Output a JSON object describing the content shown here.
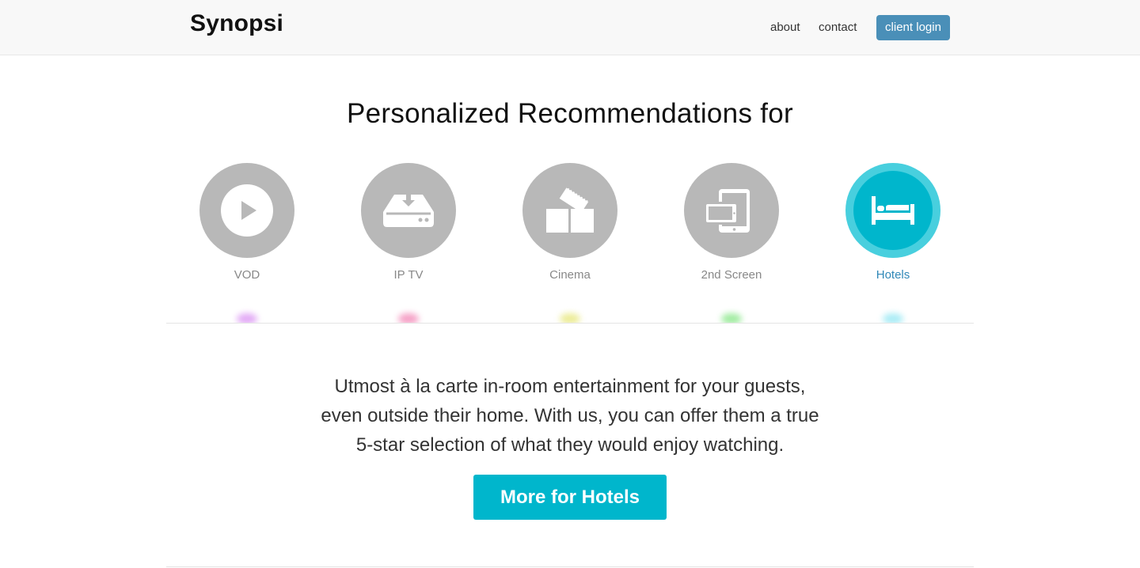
{
  "navbar": {
    "brand": "Synopsi",
    "links": [
      {
        "label": "about"
      },
      {
        "label": "contact"
      }
    ],
    "login_label": "client login"
  },
  "hero": {
    "headline": "Personalized Recommendations for"
  },
  "segments": [
    {
      "label": "VOD",
      "icon": "play-icon",
      "active": false
    },
    {
      "label": "IP TV",
      "icon": "set-top-box-icon",
      "active": false
    },
    {
      "label": "Cinema",
      "icon": "ticket-icon",
      "active": false
    },
    {
      "label": "2nd Screen",
      "icon": "devices-icon",
      "active": false
    },
    {
      "label": "Hotels",
      "icon": "bed-icon",
      "active": true
    }
  ],
  "colors": {
    "accent": "#00b6cc",
    "accent_ring": "#48cfde",
    "inactive_circle": "#b8b8b8",
    "login_button": "#4a8fb8",
    "active_label": "#3088b8"
  },
  "detail": {
    "lines": [
      "Utmost à la carte in-room entertainment for your guests,",
      "even outside their home. With us, you can offer them a true",
      "5-star selection of what they would enjoy watching."
    ],
    "cta_label": "More for Hotels"
  }
}
